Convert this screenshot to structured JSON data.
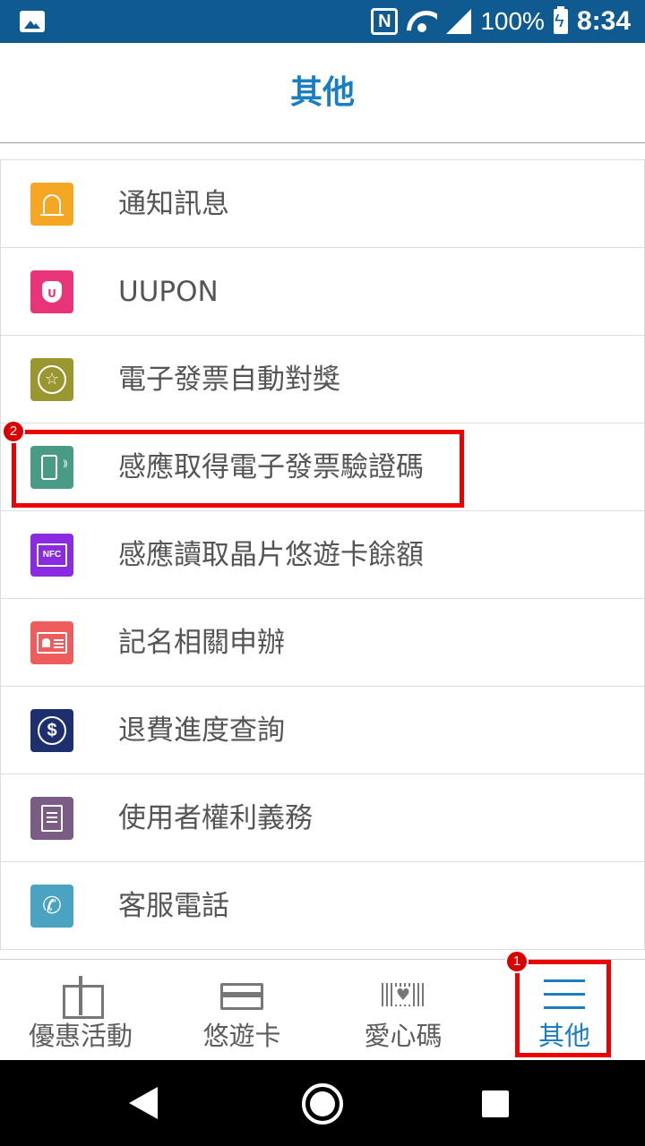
{
  "status_bar": {
    "battery": "100%",
    "time": "8:34",
    "icons": [
      "image-icon",
      "nfc-icon",
      "wifi-icon",
      "signal-icon",
      "battery-charging-icon"
    ]
  },
  "header": {
    "title": "其他"
  },
  "menu": {
    "items": [
      {
        "label": "通知訊息",
        "icon": "bell-icon",
        "color": "#f5a623"
      },
      {
        "label": "UUPON",
        "icon": "acorn-icon",
        "color": "#e8357a"
      },
      {
        "label": "電子發票自動對獎",
        "icon": "star-badge-icon",
        "color": "#9a9630"
      },
      {
        "label": "感應取得電子發票驗證碼",
        "icon": "phone-tap-icon",
        "color": "#4a9a88"
      },
      {
        "label": "感應讀取晶片悠遊卡餘額",
        "icon": "nfc-bubble-icon",
        "color": "#8a2be2"
      },
      {
        "label": "記名相關申辦",
        "icon": "id-card-icon",
        "color": "#ef5c5c"
      },
      {
        "label": "退費進度查詢",
        "icon": "dollar-icon",
        "color": "#1e2f6e"
      },
      {
        "label": "使用者權利義務",
        "icon": "document-icon",
        "color": "#7a5c85"
      },
      {
        "label": "客服電話",
        "icon": "phone-icon",
        "color": "#4aa3c1"
      }
    ],
    "nfc_text": "NFC",
    "acorn_text": "U",
    "dollar_text": "$"
  },
  "annotations": {
    "badge_1": "1",
    "badge_2": "2",
    "highlight_color": "#ee0000"
  },
  "bottom_nav": {
    "tabs": [
      {
        "label": "優惠活動",
        "icon": "gift-icon"
      },
      {
        "label": "悠遊卡",
        "icon": "card-icon"
      },
      {
        "label": "愛心碼",
        "icon": "barcode-heart-icon"
      },
      {
        "label": "其他",
        "icon": "menu-icon",
        "active": true
      }
    ],
    "active_color": "#1a7fc1"
  },
  "system_nav": {
    "icons": [
      "back-icon",
      "home-icon",
      "recent-apps-icon"
    ]
  },
  "colors": {
    "status_bar": "#0f5a91",
    "accent": "#1a7fc1"
  }
}
